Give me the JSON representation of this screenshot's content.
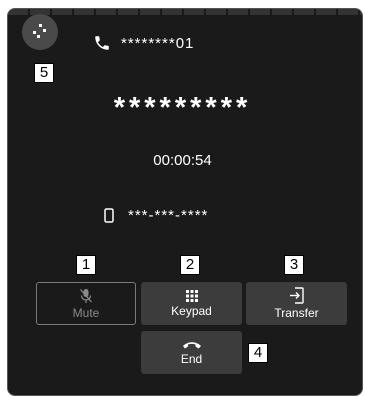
{
  "call": {
    "number": "********01",
    "caller_name": "*********",
    "duration": "00:00:54",
    "mobile_number": "***-***-****"
  },
  "actions": {
    "mute_label": "Mute",
    "keypad_label": "Keypad",
    "transfer_label": "Transfer",
    "end_label": "End"
  },
  "callouts": {
    "c1": "1",
    "c2": "2",
    "c3": "3",
    "c4": "4",
    "c5": "5"
  },
  "icons": {
    "call_list": "call-list-icon",
    "phone": "phone-icon",
    "mobile": "mobile-phone-icon",
    "mute": "microphone-muted-icon",
    "keypad": "keypad-grid-icon",
    "transfer": "transfer-phone-icon",
    "end": "handset-hangup-icon"
  },
  "colors": {
    "screen_bg": "#1a1a1a",
    "button_bg": "#3c3c3c",
    "text": "#ffffff",
    "disabled_text": "#8a8a8a"
  }
}
